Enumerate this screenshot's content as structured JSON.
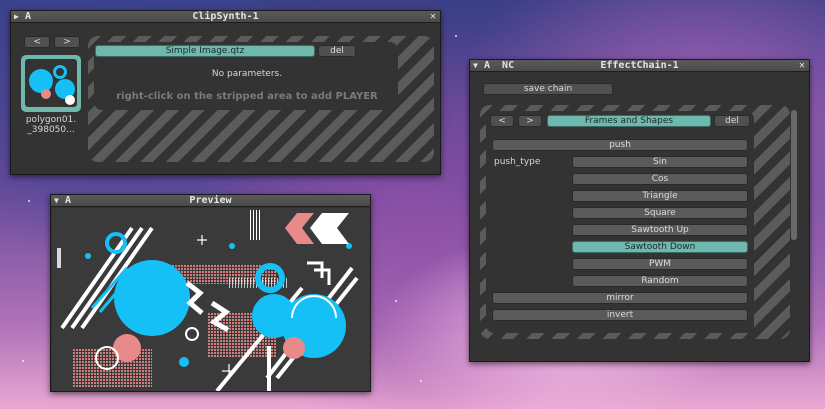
{
  "clipsynth": {
    "arrow": "▶",
    "label_left": "A",
    "title": "ClipSynth-1",
    "close": "✕",
    "prev_button": "<",
    "next_button": ">",
    "thumb_label_line1": "polygon01.",
    "thumb_label_line2": "_398050...",
    "player_name": "Simple Image.qtz",
    "del_button": "del",
    "no_params": "No parameters.",
    "hint": "right-click on the stripped area to add PLAYER"
  },
  "preview": {
    "arrow": "▼",
    "label_left": "A",
    "title": "Preview"
  },
  "effectchain": {
    "arrow": "▼",
    "label_left": "A  NC",
    "title": "EffectChain-1",
    "close": "✕",
    "save_chain": "save chain",
    "prev_button": "<",
    "next_button": ">",
    "effect_name": "Frames and Shapes",
    "del_button": "del",
    "push_label": "push",
    "push_type_label": "push_type",
    "push_type_options": [
      "Sin",
      "Cos",
      "Triangle",
      "Square",
      "Sawtooth Up",
      "Sawtooth Down",
      "PWM",
      "Random"
    ],
    "push_type_selected": "Sawtooth Down",
    "mirror_label": "mirror",
    "invert_label": "invert"
  },
  "colors": {
    "accent": "#6fb8ae",
    "preview_cyan": "#14c0f5",
    "preview_pink": "#e98a8a"
  }
}
